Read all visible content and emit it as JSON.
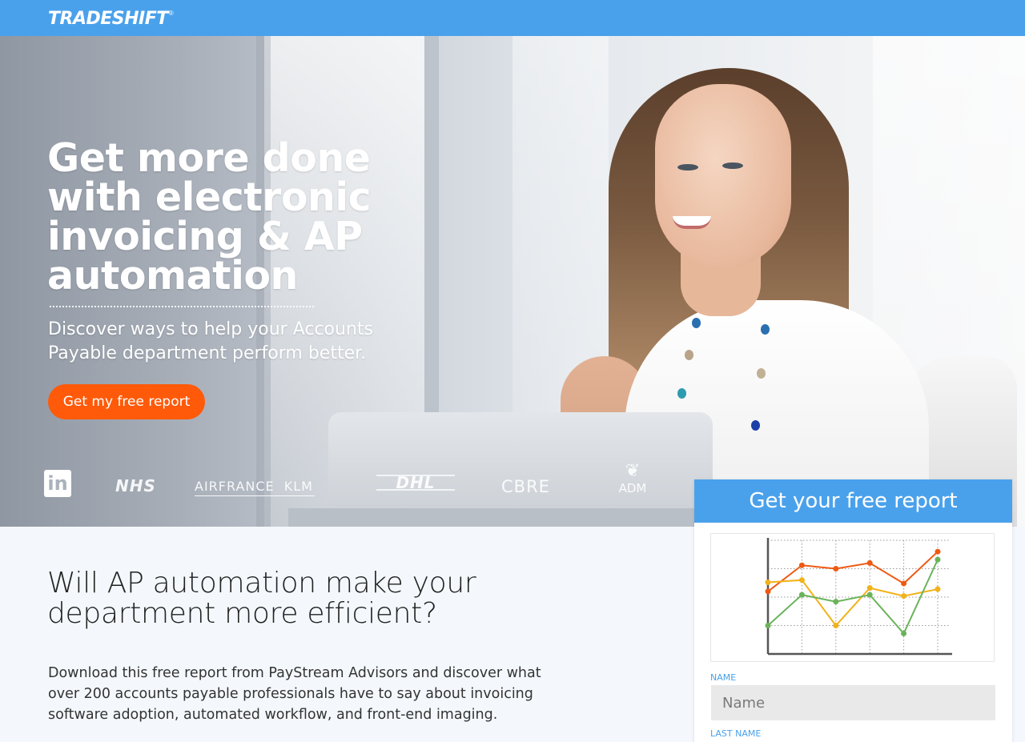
{
  "header": {
    "logo_text": "TRADESHIFT",
    "logo_mark": "®",
    "brand_color": "#4aa1eb"
  },
  "hero": {
    "title": "Get more done with electronic invoicing & AP automation",
    "subtitle": "Discover ways to help your Accounts Payable department perform better.",
    "cta_label": "Get my free report",
    "cta_color": "#ff5a0a"
  },
  "client_logos": [
    "LinkedIn",
    "NHS",
    "AIRFRANCE KLM",
    "DHL",
    "CBRE",
    "ADM"
  ],
  "logo_texts": {
    "linkedin": "in",
    "nhs": "NHS",
    "airfrance": "AIRFRANCE",
    "klm": "KLM",
    "dhl": "DHL",
    "cbre": "CBRE",
    "adm": "ADM"
  },
  "form": {
    "heading": "Get your free report",
    "name_label": "NAME",
    "name_placeholder": "Name",
    "last_name_label": "LAST NAME"
  },
  "section": {
    "title": "Will AP automation make your department more efficient?",
    "body": "Download this free report from PayStream Advisors and discover what over 200 accounts payable professionals have to say about invoicing software adoption, automated workflow, and front-end imaging."
  },
  "chart_data": {
    "type": "line",
    "x": [
      1,
      2,
      3,
      4,
      5,
      6
    ],
    "series": [
      {
        "color": "#ee5a14",
        "values": [
          55,
          78,
          75,
          80,
          62,
          90
        ]
      },
      {
        "color": "#f2b21a",
        "values": [
          63,
          65,
          25,
          58,
          51,
          57
        ]
      },
      {
        "color": "#6ab35a",
        "values": [
          25,
          52,
          46,
          52,
          18,
          83
        ]
      }
    ],
    "ylim": [
      0,
      100
    ],
    "grid": true
  }
}
